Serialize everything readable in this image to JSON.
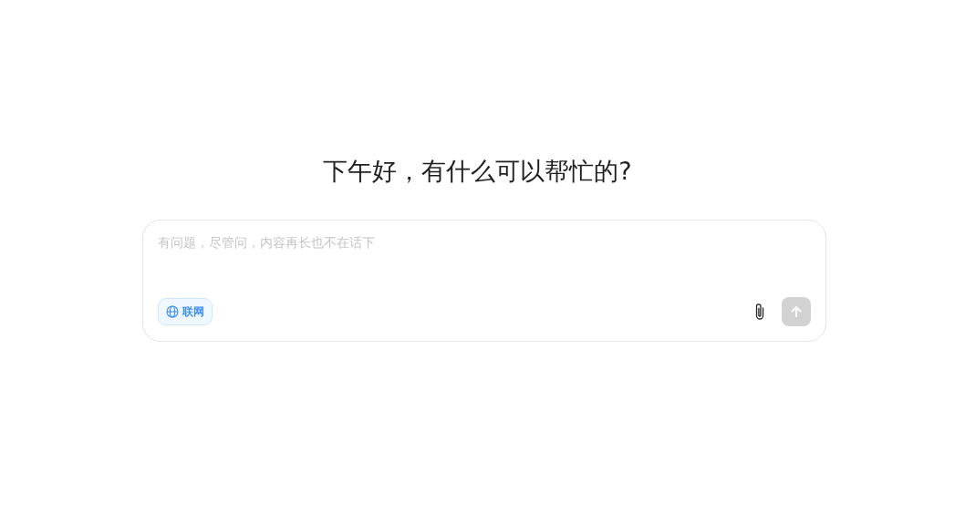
{
  "greeting": "下午好，有什么可以帮忙的?",
  "composer": {
    "placeholder": "有问题，尽管问，内容再长也不在话下",
    "web_toggle": {
      "label": "联网",
      "selected": true
    },
    "send_button": {
      "disabled": true
    }
  }
}
